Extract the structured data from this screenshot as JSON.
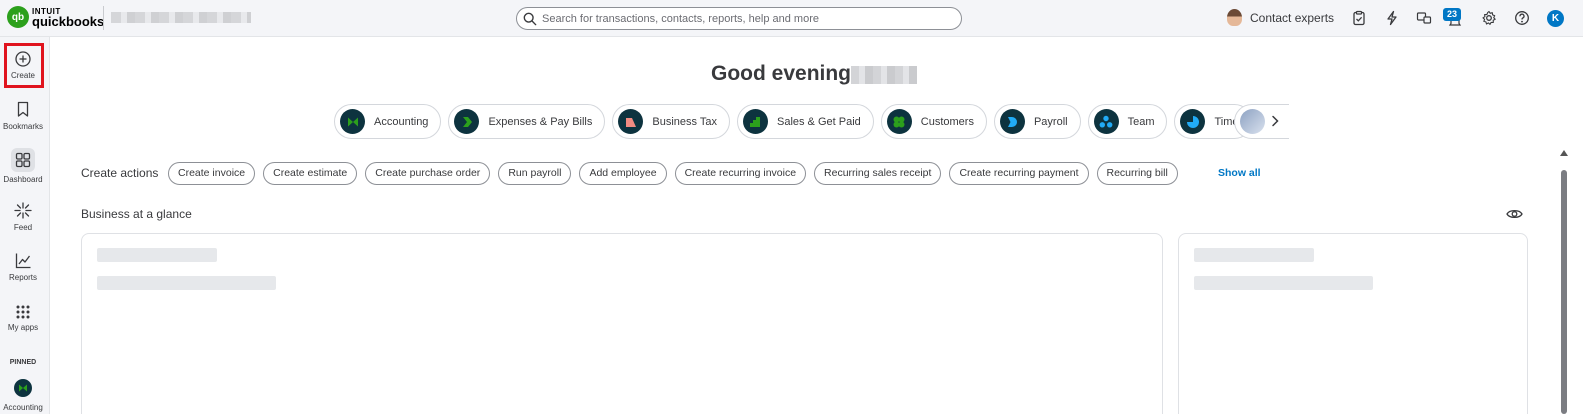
{
  "header": {
    "logo_line1": "INTUIT",
    "logo_line2": "quickbooks",
    "logo_mark": "qb",
    "search_placeholder": "Search for transactions, contacts, reports, help and more",
    "contact_label": "Contact experts",
    "notification_count": "23",
    "user_initial": "K",
    "icons": [
      "search-icon",
      "tasks-icon",
      "lightning-icon",
      "apps-switch-icon",
      "notifications-icon",
      "gear-icon",
      "help-icon"
    ]
  },
  "sidebar": {
    "items": [
      {
        "label": "Create",
        "icon": "plus-circle-icon"
      },
      {
        "label": "Bookmarks",
        "icon": "bookmark-icon"
      },
      {
        "label": "Dashboard",
        "icon": "dashboard-icon"
      },
      {
        "label": "Feed",
        "icon": "feed-icon"
      },
      {
        "label": "Reports",
        "icon": "reports-icon"
      },
      {
        "label": "My apps",
        "icon": "grid-icon"
      }
    ],
    "pinned_label": "PINNED",
    "pinned_item": "Accounting"
  },
  "main": {
    "greeting": "Good evening",
    "categories": [
      {
        "label": "Accounting",
        "color": "#0d333f",
        "accent": "#2ca01c"
      },
      {
        "label": "Expenses & Pay Bills",
        "color": "#0d333f",
        "accent": "#2ca01c"
      },
      {
        "label": "Business Tax",
        "color": "#0d333f",
        "accent": "#f28b82"
      },
      {
        "label": "Sales & Get Paid",
        "color": "#0d333f",
        "accent": "#2ca01c"
      },
      {
        "label": "Customers",
        "color": "#0d333f",
        "accent": "#2ca01c"
      },
      {
        "label": "Payroll",
        "color": "#0d333f",
        "accent": "#21abf6"
      },
      {
        "label": "Team",
        "color": "#0d333f",
        "accent": "#21abf6"
      },
      {
        "label": "Time",
        "color": "#0d333f",
        "accent": "#21abf6"
      }
    ],
    "create_actions_label": "Create actions",
    "create_actions": [
      "Create invoice",
      "Create estimate",
      "Create purchase order",
      "Run payroll",
      "Add employee",
      "Create recurring invoice",
      "Recurring sales receipt",
      "Create recurring payment",
      "Recurring bill"
    ],
    "show_all": "Show all",
    "glance_title": "Business at a glance"
  },
  "colors": {
    "brand_green": "#2ca01c",
    "link_blue": "#0077c5",
    "highlight_red": "#e0141e",
    "dark_teal": "#0d333f"
  }
}
